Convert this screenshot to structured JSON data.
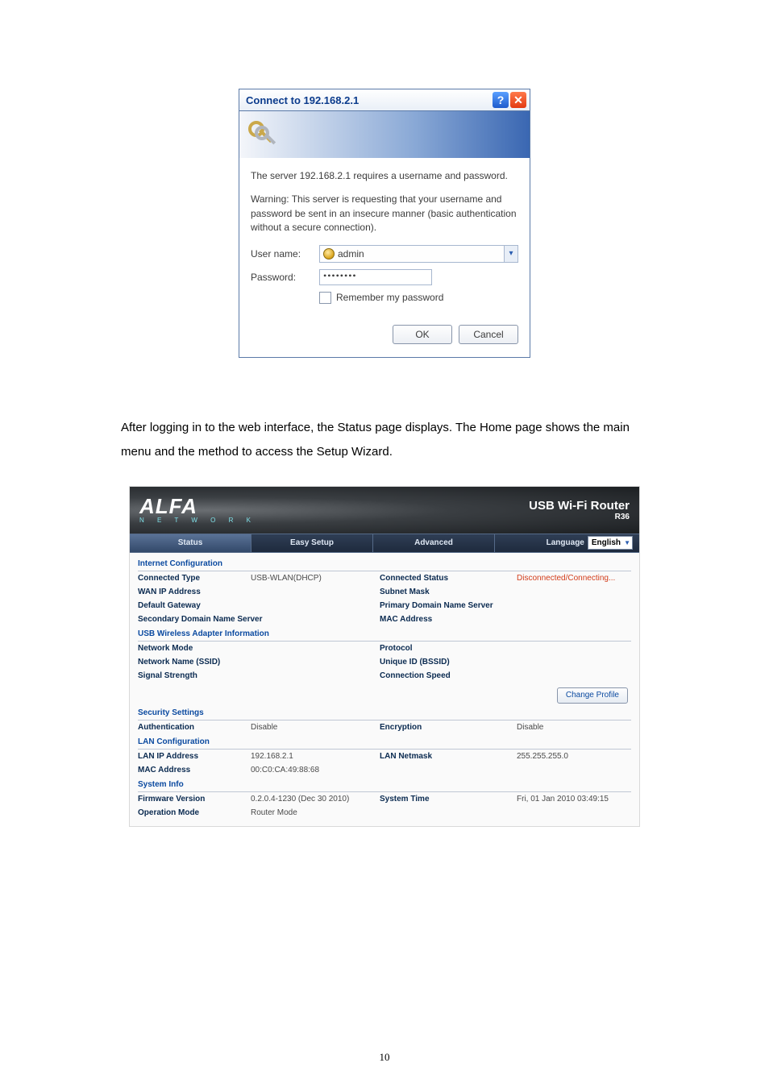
{
  "dialog": {
    "title": "Connect to 192.168.2.1",
    "server_msg": "The server 192.168.2.1 requires a username and password.",
    "warning_msg": "Warning: This server is requesting that your username and password be sent in an insecure manner (basic authentication without a secure connection).",
    "username_label": "User name:",
    "username_value": "admin",
    "password_label": "Password:",
    "password_value": "••••••••",
    "remember_label": "Remember my password",
    "ok_label": "OK",
    "cancel_label": "Cancel"
  },
  "paragraph": "After logging in to the web interface, the Status page displays. The Home page shows the main menu and the method to access the Setup Wizard.",
  "router": {
    "brand": "ALFA",
    "brand_sub": "N E T W O R K",
    "header_title": "USB Wi-Fi Router",
    "header_model": "R36",
    "tabs": {
      "status": "Status",
      "easy": "Easy Setup",
      "adv": "Advanced"
    },
    "language_label": "Language",
    "language_value": "English",
    "sections": {
      "internet": "Internet Configuration",
      "usb": "USB Wireless Adapter Information",
      "security": "Security Settings",
      "lan": "LAN Configuration",
      "system": "System Info"
    },
    "labels": {
      "connected_type": "Connected Type",
      "connected_status": "Connected Status",
      "wan_ip": "WAN IP Address",
      "subnet_mask": "Subnet Mask",
      "default_gw": "Default Gateway",
      "primary_dns": "Primary Domain Name Server",
      "secondary_dns": "Secondary Domain Name Server",
      "mac_address": "MAC Address",
      "network_mode": "Network Mode",
      "protocol": "Protocol",
      "ssid": "Network Name (SSID)",
      "bssid": "Unique ID (BSSID)",
      "signal": "Signal Strength",
      "conn_speed": "Connection Speed",
      "change_profile": "Change Profile",
      "auth": "Authentication",
      "enc": "Encryption",
      "lan_ip": "LAN IP Address",
      "lan_netmask": "LAN Netmask",
      "lan_mac": "MAC Address",
      "fw": "Firmware Version",
      "sys_time": "System Time",
      "op_mode": "Operation Mode"
    },
    "values": {
      "connected_type": "USB-WLAN(DHCP)",
      "connected_status": "Disconnected/Connecting...",
      "auth": "Disable",
      "enc": "Disable",
      "lan_ip": "192.168.2.1",
      "lan_netmask": "255.255.255.0",
      "lan_mac": "00:C0:CA:49:88:68",
      "fw": "0.2.0.4-1230 (Dec 30 2010)",
      "sys_time": "Fri, 01 Jan 2010 03:49:15",
      "op_mode": "Router Mode"
    }
  },
  "page_number": "10"
}
